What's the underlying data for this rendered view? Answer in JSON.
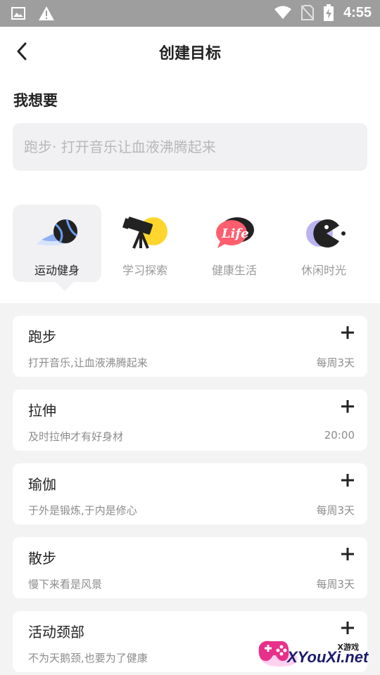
{
  "status_bar": {
    "time": "4:55",
    "icons": [
      "image-icon",
      "warning-icon",
      "wifi-icon",
      "no-sim-icon",
      "battery-charging-icon"
    ]
  },
  "header": {
    "title": "创建目标",
    "back_icon": "chevron-left-icon"
  },
  "goal": {
    "label": "我想要",
    "placeholder": "跑步· 打开音乐让血液沸腾起来",
    "value": ""
  },
  "categories": [
    {
      "label": "运动健身",
      "icon": "sports-ball-icon",
      "active": true
    },
    {
      "label": "学习探索",
      "icon": "telescope-icon",
      "active": false
    },
    {
      "label": "健康生活",
      "icon": "life-bubble-icon",
      "active": false
    },
    {
      "label": "休闲时光",
      "icon": "pacman-icon",
      "active": false
    }
  ],
  "goals_list": [
    {
      "title": "跑步",
      "desc": "打开音乐,让血液沸腾起来",
      "freq": "每周3天"
    },
    {
      "title": "拉伸",
      "desc": "及时拉伸才有好身材",
      "freq": "20:00"
    },
    {
      "title": "瑜伽",
      "desc": "于外是锻炼,于内是修心",
      "freq": "每周3天"
    },
    {
      "title": "散步",
      "desc": "慢下来看是风景",
      "freq": "每周3天"
    },
    {
      "title": "活动颈部",
      "desc": "不为天鹅颈,也要为了健康",
      "freq": ""
    }
  ],
  "watermark": {
    "small": "X游戏",
    "main": "XYouXi.net"
  },
  "colors": {
    "accent_yellow": "#ffd52e",
    "text_dark": "#222222",
    "text_muted": "#8c8c8c",
    "page_bg": "#f3f3f3",
    "input_bg": "#f1f1f3"
  }
}
